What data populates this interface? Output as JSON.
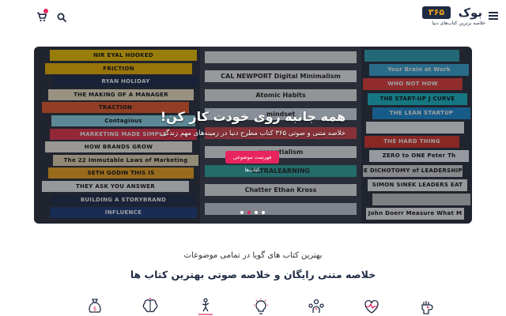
{
  "header": {
    "logo_badge": "۳۶۵",
    "logo_word": "بوک",
    "logo_tagline": "خلاصه برترین کتاب‌های دنیا",
    "icons": [
      "menu-icon",
      "search-icon",
      "cart-icon"
    ]
  },
  "hero": {
    "title": "همه جانبه روی خودت کار کن!",
    "subtitle": "خلاصه متنی و صوتی ۳۶۵ کتاب مطرح دنیا در زمینه‌های مهم زندگی",
    "button": "فهرست موضوعی کتاب‌ها",
    "slides": 4,
    "active_slide": 1,
    "books_left": [
      {
        "t": "NIR EYAL   HOOKED",
        "c": "#f3c400"
      },
      {
        "t": "FRICTION",
        "c": "#f2b600"
      },
      {
        "t": "RYAN HOLIDAY",
        "c": "#1d2a4a",
        "d": true
      },
      {
        "t": "THE MAKING OF A MANAGER",
        "c": "#f4e6c6"
      },
      {
        "t": "TRACTION",
        "c": "#e95a2b"
      },
      {
        "t": "Contagious",
        "c": "#8fd6e6"
      },
      {
        "t": "MARKETING MADE SIMPLE",
        "c": "#e9344b",
        "d": true
      },
      {
        "t": "HOW BRANDS GROW",
        "c": "#f3efe4"
      },
      {
        "t": "The 22 Immutable Laws of Marketing",
        "c": "#e8d9b4"
      },
      {
        "t": "SETH GODIN   THIS IS",
        "c": "#f2a61d"
      },
      {
        "t": "THEY ASK YOU ANSWER",
        "c": "#f1f1f1"
      },
      {
        "t": "BUILDING A STORYBRAND",
        "c": "#1e2c48",
        "d": true
      },
      {
        "t": "INFLUENCE",
        "c": "#1d3c7a",
        "d": true
      }
    ],
    "books_mid": [
      {
        "t": "",
        "c": "#eaeaea"
      },
      {
        "t": "CAL NEWPORT   Digital Minimalism",
        "c": "#f2f2f2"
      },
      {
        "t": "Atomic Habits",
        "c": "#e9e9e9"
      },
      {
        "t": "mindset",
        "c": "#d9e2ec"
      },
      {
        "t": "",
        "c": "#d5474d"
      },
      {
        "t": "essentialism",
        "c": "#ececec"
      },
      {
        "t": "ULTRALEARNING",
        "c": "#2fa7a0"
      },
      {
        "t": "Chatter   Ethan Kross",
        "c": "#e8e8e8"
      },
      {
        "t": "",
        "c": "#c9cfd9"
      }
    ],
    "books_right": [
      {
        "t": "",
        "c": "#2fa0b5"
      },
      {
        "t": "Your Brain at Work",
        "c": "#3aa7d2",
        "d": true
      },
      {
        "t": "WHO NOT HOW",
        "c": "#e63d3a",
        "d": true
      },
      {
        "t": "THE START-UP J CURVE",
        "c": "#19b9c9"
      },
      {
        "t": "THE LEAN STARTUP",
        "c": "#1b8cd3",
        "d": true
      },
      {
        "t": "",
        "c": "#f2f2f2"
      },
      {
        "t": "THE HARD THING",
        "c": "#d9352b",
        "d": true
      },
      {
        "t": "ZERO to ONE   Peter Th",
        "c": "#eef2f8"
      },
      {
        "t": "THE DICHOTOMY of LEADERSHIP",
        "c": "#d7d7d7"
      },
      {
        "t": "SIMON SINEK   LEADERS EAT",
        "c": "#f1f1f1"
      },
      {
        "t": "",
        "c": "#c7c7c7"
      },
      {
        "t": "John Doerr   Measure What M",
        "c": "#f4f4f4"
      }
    ]
  },
  "section": {
    "subtitle": "بهترین کتاب های گویا در تمامی موضوعات",
    "title": "خلاصه متنی رایگان و خلاصه صوتی بهترین کتاب ها",
    "category_icons": [
      "fist-icon",
      "heartbeat-icon",
      "people-icon",
      "lightbulb-icon",
      "climbing-icon",
      "brain-icon",
      "money-bag-icon"
    ]
  },
  "colors": {
    "accent": "#e8245f",
    "navy": "#1f2a44",
    "logo_gold": "#f2a21b"
  }
}
